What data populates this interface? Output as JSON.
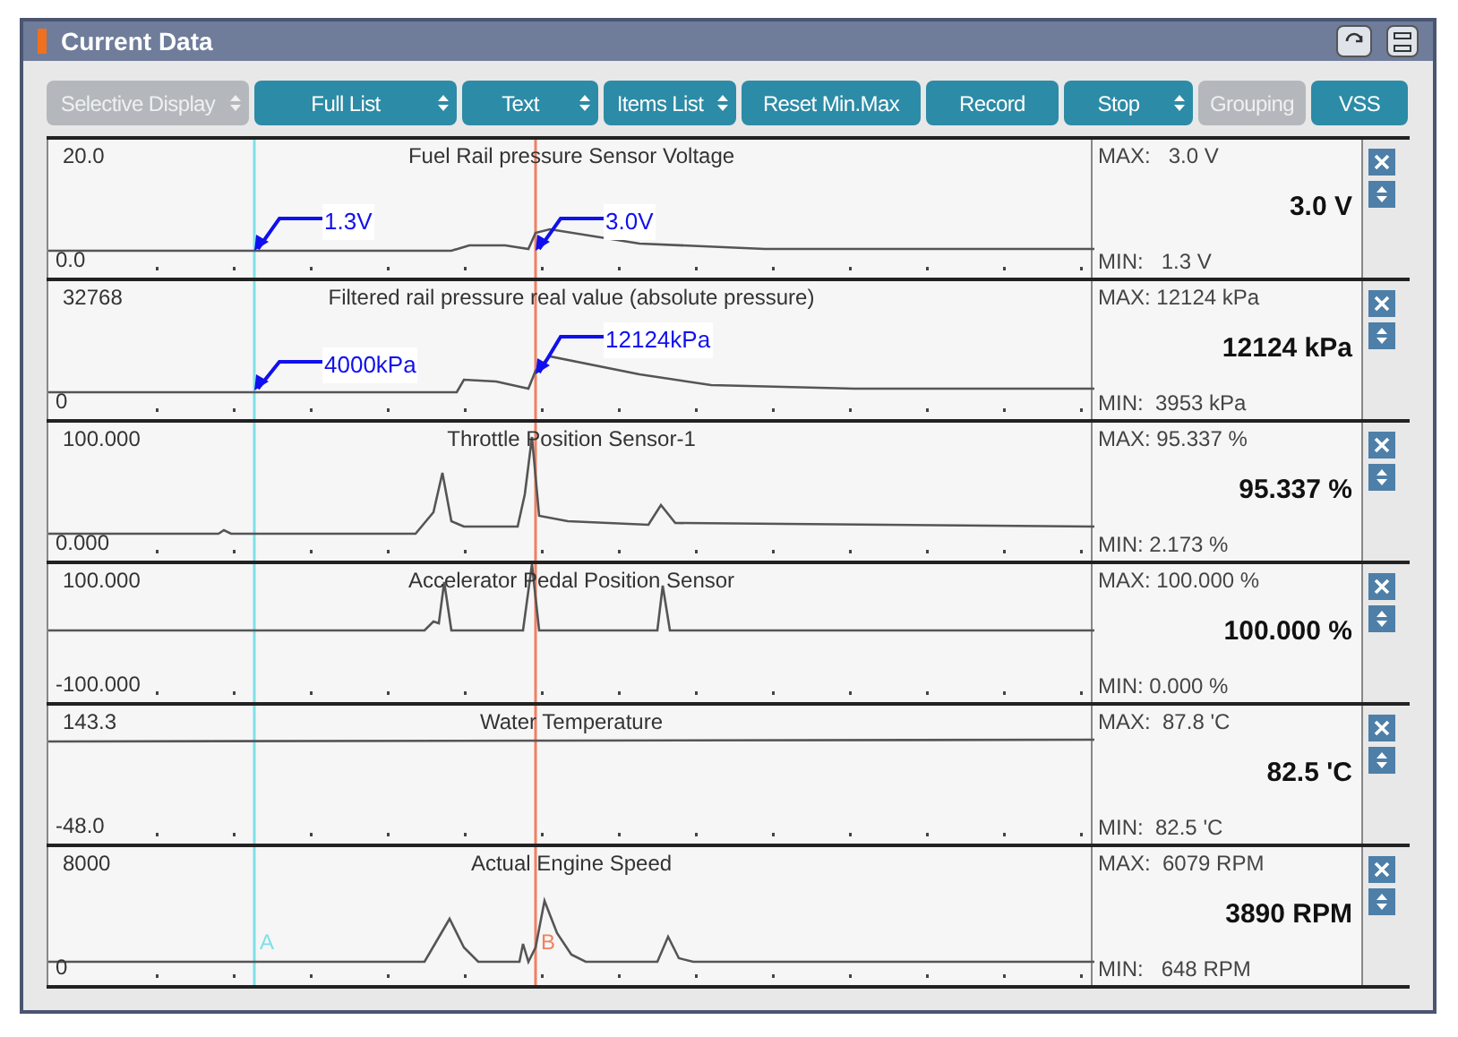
{
  "window": {
    "title": "Current Data"
  },
  "toolbar": [
    {
      "label": "Selective Display",
      "disabled": true,
      "dropdown": true
    },
    {
      "label": "Full List",
      "disabled": false,
      "dropdown": true
    },
    {
      "label": "Text",
      "disabled": false,
      "dropdown": true
    },
    {
      "label": "Items List",
      "disabled": false,
      "dropdown": true
    },
    {
      "label": "Reset Min.Max",
      "disabled": false,
      "dropdown": false
    },
    {
      "label": "Record",
      "disabled": false,
      "dropdown": false
    },
    {
      "label": "Stop",
      "disabled": false,
      "dropdown": true
    },
    {
      "label": "Grouping",
      "disabled": true,
      "dropdown": false
    },
    {
      "label": "VSS",
      "disabled": false,
      "dropdown": false
    }
  ],
  "cursors": [
    {
      "label": "A",
      "color": "#80e0e8"
    },
    {
      "label": "B",
      "color": "#f08060"
    }
  ],
  "panels": [
    {
      "title": "Fuel Rail pressure Sensor Voltage",
      "scale_max": "20.0",
      "scale_min": "0.0",
      "max": "MAX:   3.0 V",
      "value": "3.0 V",
      "min": "MIN:   1.3 V",
      "annotations": [
        {
          "text": "1.3V"
        },
        {
          "text": "3.0V"
        }
      ]
    },
    {
      "title": "Filtered rail pressure real value (absolute pressure)",
      "scale_max": "32768",
      "scale_min": "0",
      "max": "MAX: 12124 kPa",
      "value": "12124 kPa",
      "min": "MIN:  3953 kPa",
      "annotations": [
        {
          "text": "4000kPa"
        },
        {
          "text": "12124kPa"
        }
      ]
    },
    {
      "title": "Throttle Position Sensor-1",
      "scale_max": "100.000",
      "scale_min": "0.000",
      "max": "MAX: 95.337 %",
      "value": "95.337 %",
      "min": "MIN: 2.173 %"
    },
    {
      "title": "Accelerator Pedal Position Sensor",
      "scale_max": "100.000",
      "scale_min": "-100.000",
      "max": "MAX: 100.000 %",
      "value": "100.000 %",
      "min": "MIN: 0.000 %"
    },
    {
      "title": "Water Temperature",
      "scale_max": "143.3",
      "scale_min": "-48.0",
      "max": "MAX:  87.8 'C",
      "value": "82.5 'C",
      "min": "MIN:  82.5 'C"
    },
    {
      "title": "Actual Engine Speed",
      "scale_max": "8000",
      "scale_min": "0",
      "max": "MAX:  6079 RPM",
      "value": "3890 RPM",
      "min": "MIN:   648 RPM"
    }
  ]
}
